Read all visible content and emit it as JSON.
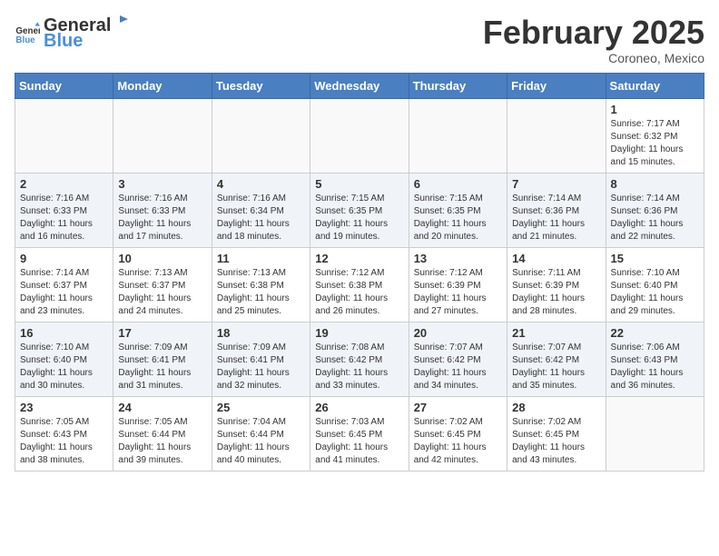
{
  "header": {
    "logo_general": "General",
    "logo_blue": "Blue",
    "title": "February 2025",
    "subtitle": "Coroneo, Mexico"
  },
  "calendar": {
    "days_of_week": [
      "Sunday",
      "Monday",
      "Tuesday",
      "Wednesday",
      "Thursday",
      "Friday",
      "Saturday"
    ],
    "weeks": [
      [
        {
          "day": "",
          "info": ""
        },
        {
          "day": "",
          "info": ""
        },
        {
          "day": "",
          "info": ""
        },
        {
          "day": "",
          "info": ""
        },
        {
          "day": "",
          "info": ""
        },
        {
          "day": "",
          "info": ""
        },
        {
          "day": "1",
          "info": "Sunrise: 7:17 AM\nSunset: 6:32 PM\nDaylight: 11 hours\nand 15 minutes."
        }
      ],
      [
        {
          "day": "2",
          "info": "Sunrise: 7:16 AM\nSunset: 6:33 PM\nDaylight: 11 hours\nand 16 minutes."
        },
        {
          "day": "3",
          "info": "Sunrise: 7:16 AM\nSunset: 6:33 PM\nDaylight: 11 hours\nand 17 minutes."
        },
        {
          "day": "4",
          "info": "Sunrise: 7:16 AM\nSunset: 6:34 PM\nDaylight: 11 hours\nand 18 minutes."
        },
        {
          "day": "5",
          "info": "Sunrise: 7:15 AM\nSunset: 6:35 PM\nDaylight: 11 hours\nand 19 minutes."
        },
        {
          "day": "6",
          "info": "Sunrise: 7:15 AM\nSunset: 6:35 PM\nDaylight: 11 hours\nand 20 minutes."
        },
        {
          "day": "7",
          "info": "Sunrise: 7:14 AM\nSunset: 6:36 PM\nDaylight: 11 hours\nand 21 minutes."
        },
        {
          "day": "8",
          "info": "Sunrise: 7:14 AM\nSunset: 6:36 PM\nDaylight: 11 hours\nand 22 minutes."
        }
      ],
      [
        {
          "day": "9",
          "info": "Sunrise: 7:14 AM\nSunset: 6:37 PM\nDaylight: 11 hours\nand 23 minutes."
        },
        {
          "day": "10",
          "info": "Sunrise: 7:13 AM\nSunset: 6:37 PM\nDaylight: 11 hours\nand 24 minutes."
        },
        {
          "day": "11",
          "info": "Sunrise: 7:13 AM\nSunset: 6:38 PM\nDaylight: 11 hours\nand 25 minutes."
        },
        {
          "day": "12",
          "info": "Sunrise: 7:12 AM\nSunset: 6:38 PM\nDaylight: 11 hours\nand 26 minutes."
        },
        {
          "day": "13",
          "info": "Sunrise: 7:12 AM\nSunset: 6:39 PM\nDaylight: 11 hours\nand 27 minutes."
        },
        {
          "day": "14",
          "info": "Sunrise: 7:11 AM\nSunset: 6:39 PM\nDaylight: 11 hours\nand 28 minutes."
        },
        {
          "day": "15",
          "info": "Sunrise: 7:10 AM\nSunset: 6:40 PM\nDaylight: 11 hours\nand 29 minutes."
        }
      ],
      [
        {
          "day": "16",
          "info": "Sunrise: 7:10 AM\nSunset: 6:40 PM\nDaylight: 11 hours\nand 30 minutes."
        },
        {
          "day": "17",
          "info": "Sunrise: 7:09 AM\nSunset: 6:41 PM\nDaylight: 11 hours\nand 31 minutes."
        },
        {
          "day": "18",
          "info": "Sunrise: 7:09 AM\nSunset: 6:41 PM\nDaylight: 11 hours\nand 32 minutes."
        },
        {
          "day": "19",
          "info": "Sunrise: 7:08 AM\nSunset: 6:42 PM\nDaylight: 11 hours\nand 33 minutes."
        },
        {
          "day": "20",
          "info": "Sunrise: 7:07 AM\nSunset: 6:42 PM\nDaylight: 11 hours\nand 34 minutes."
        },
        {
          "day": "21",
          "info": "Sunrise: 7:07 AM\nSunset: 6:42 PM\nDaylight: 11 hours\nand 35 minutes."
        },
        {
          "day": "22",
          "info": "Sunrise: 7:06 AM\nSunset: 6:43 PM\nDaylight: 11 hours\nand 36 minutes."
        }
      ],
      [
        {
          "day": "23",
          "info": "Sunrise: 7:05 AM\nSunset: 6:43 PM\nDaylight: 11 hours\nand 38 minutes."
        },
        {
          "day": "24",
          "info": "Sunrise: 7:05 AM\nSunset: 6:44 PM\nDaylight: 11 hours\nand 39 minutes."
        },
        {
          "day": "25",
          "info": "Sunrise: 7:04 AM\nSunset: 6:44 PM\nDaylight: 11 hours\nand 40 minutes."
        },
        {
          "day": "26",
          "info": "Sunrise: 7:03 AM\nSunset: 6:45 PM\nDaylight: 11 hours\nand 41 minutes."
        },
        {
          "day": "27",
          "info": "Sunrise: 7:02 AM\nSunset: 6:45 PM\nDaylight: 11 hours\nand 42 minutes."
        },
        {
          "day": "28",
          "info": "Sunrise: 7:02 AM\nSunset: 6:45 PM\nDaylight: 11 hours\nand 43 minutes."
        },
        {
          "day": "",
          "info": ""
        }
      ]
    ]
  }
}
